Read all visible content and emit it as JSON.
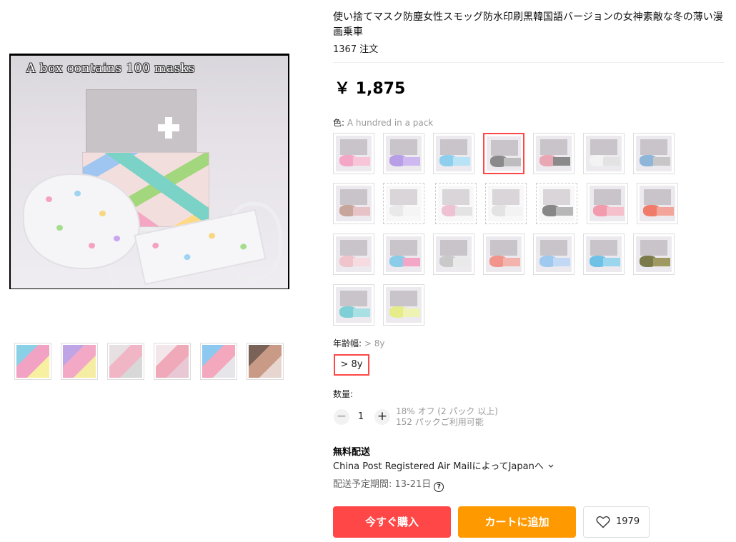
{
  "product": {
    "title": "使い捨てマスク防塵女性スモッグ防水印刷黒韓国語バージョンの女神素敵な冬の薄い漫画乗車",
    "orders": "1367 注文",
    "price": "￥ 1,875",
    "main_image_caption": "A box contains 100 masks"
  },
  "thumbnails": [
    {
      "name": "thumbnail-1",
      "colors": [
        "#8ad0e6",
        "#f2a2c3",
        "#f7f0a0"
      ]
    },
    {
      "name": "thumbnail-2",
      "colors": [
        "#bfa5e6",
        "#f3a8c6",
        "#f5eda3"
      ]
    },
    {
      "name": "thumbnail-3",
      "colors": [
        "#e6e0e2",
        "#f0b6c5",
        "#d8d8d8"
      ]
    },
    {
      "name": "thumbnail-4",
      "colors": [
        "#f3e6ea",
        "#f0a9b9",
        "#e8c8d4"
      ]
    },
    {
      "name": "thumbnail-5",
      "colors": [
        "#8cc8ef",
        "#f3a8bd",
        "#e6e6ea"
      ]
    },
    {
      "name": "thumbnail-6",
      "colors": [
        "#7a6258",
        "#c99a85",
        "#e7d6cf"
      ]
    }
  ],
  "color": {
    "label": "色:",
    "selected": "A hundred in a pack",
    "options": [
      {
        "c1": "#f3a6c6",
        "c2": "#f8c4d8",
        "empty": false
      },
      {
        "c1": "#b79ee6",
        "c2": "#cdb8f0",
        "empty": false
      },
      {
        "c1": "#8fcfee",
        "c2": "#b8e2f5",
        "empty": false
      },
      {
        "c1": "#8a8a8a",
        "c2": "#bdbdbd",
        "empty": false,
        "selected": true
      },
      {
        "c1": "#e8a7b3",
        "c2": "#8a8a8a",
        "empty": false
      },
      {
        "c1": "#f3f3f3",
        "c2": "#e3e3e3",
        "empty": false
      },
      {
        "c1": "#8fb5d9",
        "c2": "#c7c7c7",
        "empty": false
      },
      {
        "c1": "#c7a59a",
        "c2": "#e7c3c8",
        "empty": false
      },
      {
        "c1": "#e0e0e0",
        "c2": "#f1f1f1",
        "empty": true
      },
      {
        "c1": "#e9a7c3",
        "c2": "#d8d8d8",
        "empty": true
      },
      {
        "c1": "#d8d8d8",
        "c2": "#eeeeee",
        "empty": true
      },
      {
        "c1": "#555555",
        "c2": "#999999",
        "empty": true
      },
      {
        "c1": "#f29aae",
        "c2": "#f5c0cb",
        "empty": false
      },
      {
        "c1": "#f07b6b",
        "c2": "#f4a59b",
        "empty": false
      },
      {
        "c1": "#f0c4cb",
        "c2": "#f6dce0",
        "empty": false
      },
      {
        "c1": "#8bcde9",
        "c2": "#f3a6c6",
        "empty": false
      },
      {
        "c1": "#c9c9c9",
        "c2": "#e9e9e9",
        "empty": false
      },
      {
        "c1": "#f0948c",
        "c2": "#f4b4ae",
        "empty": false
      },
      {
        "c1": "#a0c9f0",
        "c2": "#c2d9f5",
        "empty": false
      },
      {
        "c1": "#6fc2e6",
        "c2": "#9bd6ef",
        "empty": false
      },
      {
        "c1": "#7a7a4a",
        "c2": "#a09a62",
        "empty": false
      },
      {
        "c1": "#7fd0d6",
        "c2": "#a9e0e3",
        "empty": false
      },
      {
        "c1": "#e6ec8a",
        "c2": "#eef3b3",
        "empty": false
      },
      {
        "c1": "#a9a6a8",
        "c2": "#cfcccd",
        "empty": false
      }
    ]
  },
  "age": {
    "label": "年齢幅:",
    "selected": "> 8y",
    "option": "> 8y"
  },
  "quantity": {
    "label": "数量:",
    "value": "1",
    "minus_symbol": "−",
    "plus_symbol": "+",
    "discount": "18% オフ (2 パック 以上)",
    "available": "152 パックご利用可能"
  },
  "shipping": {
    "title": "無料配送",
    "method": "China Post Registered Air MailによってJapanへ",
    "delivery": "配送予定期間: 13-21日"
  },
  "actions": {
    "buy_now": "今すぐ購入",
    "add_to_cart": "カートに追加",
    "wishlist_count": "1979"
  },
  "colors": {
    "accent_red": "#ff4747",
    "accent_orange": "#ff9900"
  }
}
